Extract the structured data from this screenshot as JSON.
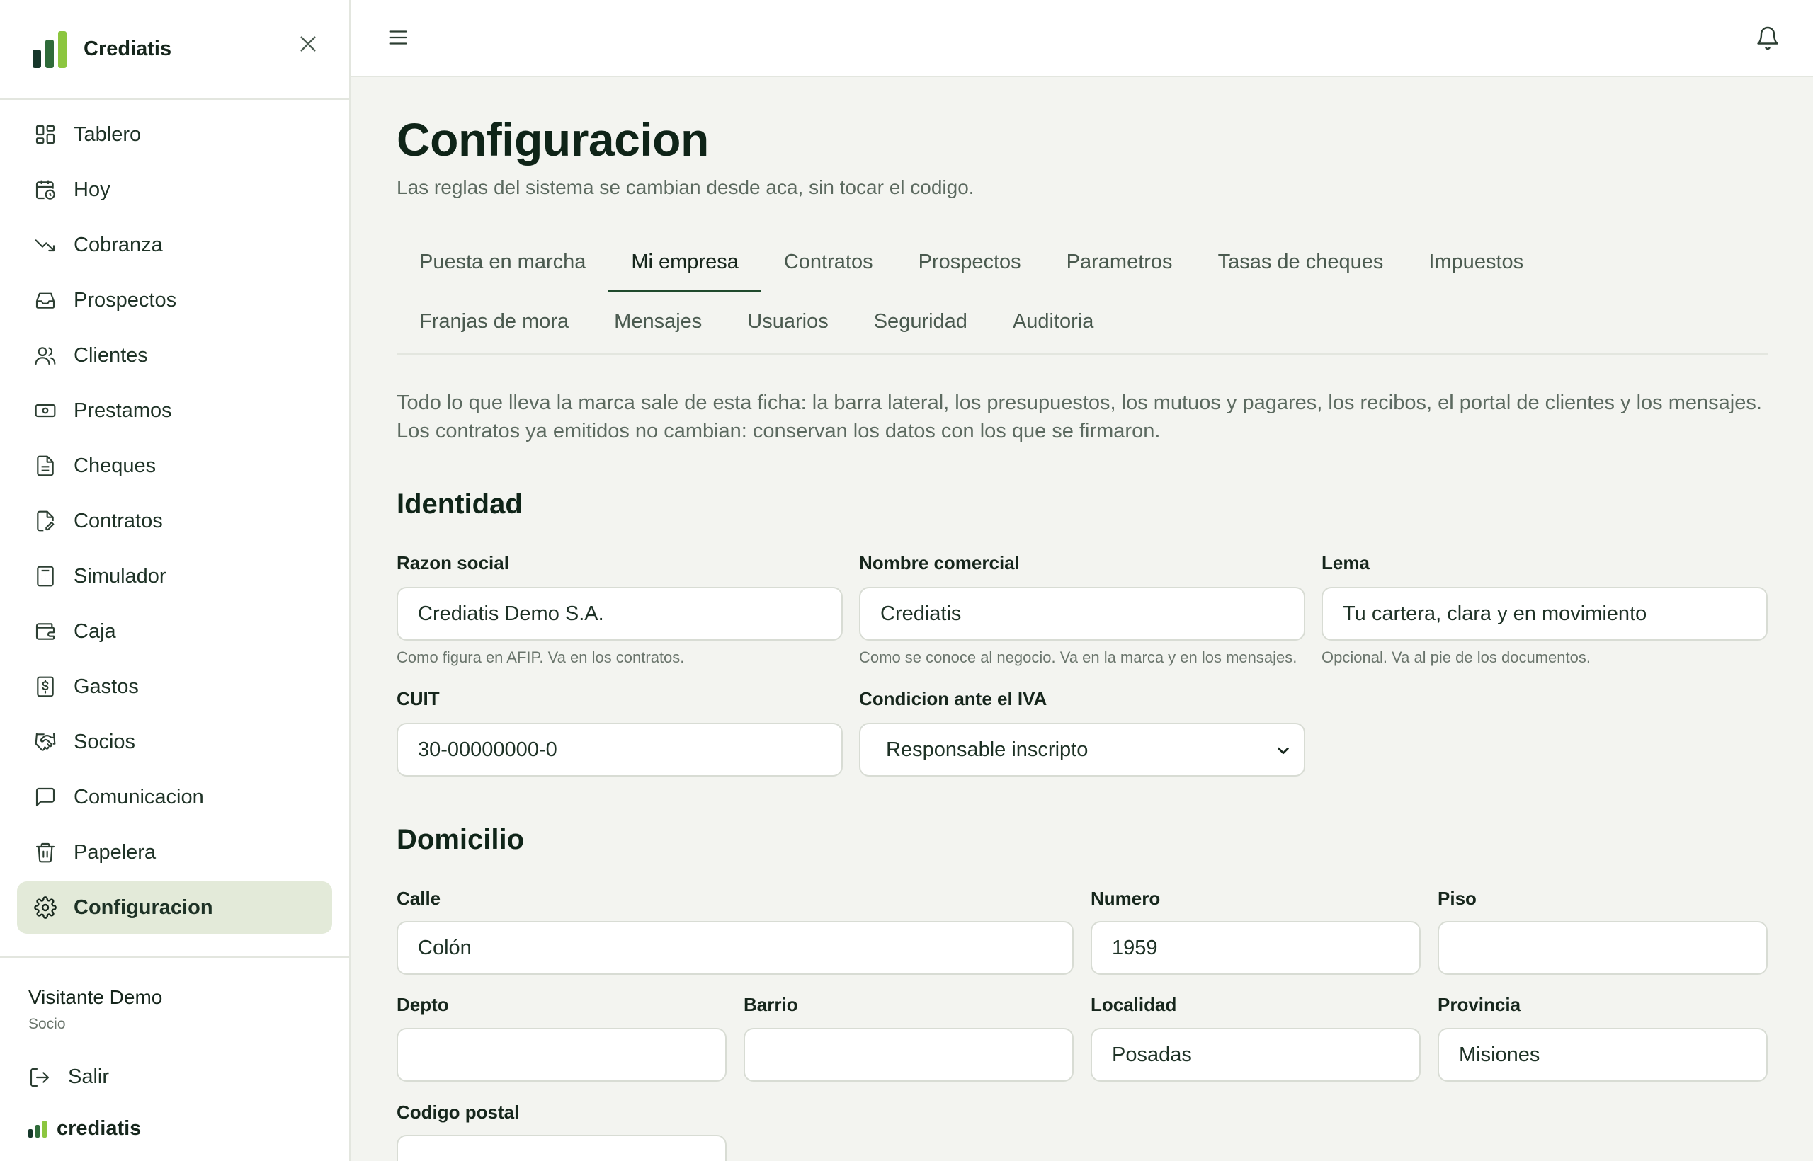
{
  "brand": {
    "name": "Crediatis",
    "logo_colors": [
      "#16372a",
      "#2f6b3a",
      "#8cc63f"
    ]
  },
  "sidebar": {
    "items": [
      {
        "label": "Tablero",
        "icon": "dashboard-icon"
      },
      {
        "label": "Hoy",
        "icon": "calendar-clock-icon"
      },
      {
        "label": "Cobranza",
        "icon": "trending-down-icon"
      },
      {
        "label": "Prospectos",
        "icon": "inbox-icon"
      },
      {
        "label": "Clientes",
        "icon": "users-icon"
      },
      {
        "label": "Prestamos",
        "icon": "banknote-icon"
      },
      {
        "label": "Cheques",
        "icon": "document-icon"
      },
      {
        "label": "Contratos",
        "icon": "file-signature-icon"
      },
      {
        "label": "Simulador",
        "icon": "calculator-icon"
      },
      {
        "label": "Caja",
        "icon": "wallet-icon"
      },
      {
        "label": "Gastos",
        "icon": "receipt-dollar-icon"
      },
      {
        "label": "Socios",
        "icon": "handshake-icon"
      },
      {
        "label": "Comunicacion",
        "icon": "message-icon"
      },
      {
        "label": "Papelera",
        "icon": "trash-icon"
      },
      {
        "label": "Configuracion",
        "icon": "gear-icon",
        "active": true
      }
    ],
    "user": {
      "name": "Visitante Demo",
      "role": "Socio"
    },
    "logout_label": "Salir",
    "footer_brand": "crediatis"
  },
  "page": {
    "title": "Configuracion",
    "subtitle": "Las reglas del sistema se cambian desde aca, sin tocar el codigo."
  },
  "tabs": {
    "row1": [
      "Puesta en marcha",
      "Mi empresa",
      "Contratos",
      "Prospectos",
      "Parametros",
      "Tasas de cheques",
      "Impuestos"
    ],
    "row2": [
      "Franjas de mora",
      "Mensajes",
      "Usuarios",
      "Seguridad",
      "Auditoria"
    ],
    "active": "Mi empresa"
  },
  "intro": {
    "line1": "Todo lo que lleva la marca sale de esta ficha: la barra lateral, los presupuestos, los mutuos y pagares, los recibos, el portal de clientes y los mensajes.",
    "line2": "Los contratos ya emitidos no cambian: conservan los datos con los que se firmaron."
  },
  "identidad": {
    "title": "Identidad",
    "razon_social": {
      "label": "Razon social",
      "value": "Crediatis Demo S.A.",
      "hint": "Como figura en AFIP. Va en los contratos."
    },
    "nombre_comercial": {
      "label": "Nombre comercial",
      "value": "Crediatis",
      "hint": "Como se conoce al negocio. Va en la marca y en los mensajes."
    },
    "lema": {
      "label": "Lema",
      "value": "Tu cartera, clara y en movimiento",
      "hint": "Opcional. Va al pie de los documentos."
    },
    "cuit": {
      "label": "CUIT",
      "value": "30-00000000-0"
    },
    "iva": {
      "label": "Condicion ante el IVA",
      "value": "Responsable inscripto"
    }
  },
  "domicilio": {
    "title": "Domicilio",
    "calle": {
      "label": "Calle",
      "value": "Colón"
    },
    "numero": {
      "label": "Numero",
      "value": "1959"
    },
    "piso": {
      "label": "Piso",
      "value": ""
    },
    "depto": {
      "label": "Depto",
      "value": ""
    },
    "barrio": {
      "label": "Barrio",
      "value": ""
    },
    "localidad": {
      "label": "Localidad",
      "value": "Posadas"
    },
    "provincia": {
      "label": "Provincia",
      "value": "Misiones"
    },
    "codigo_postal": {
      "label": "Codigo postal",
      "value": ""
    }
  }
}
